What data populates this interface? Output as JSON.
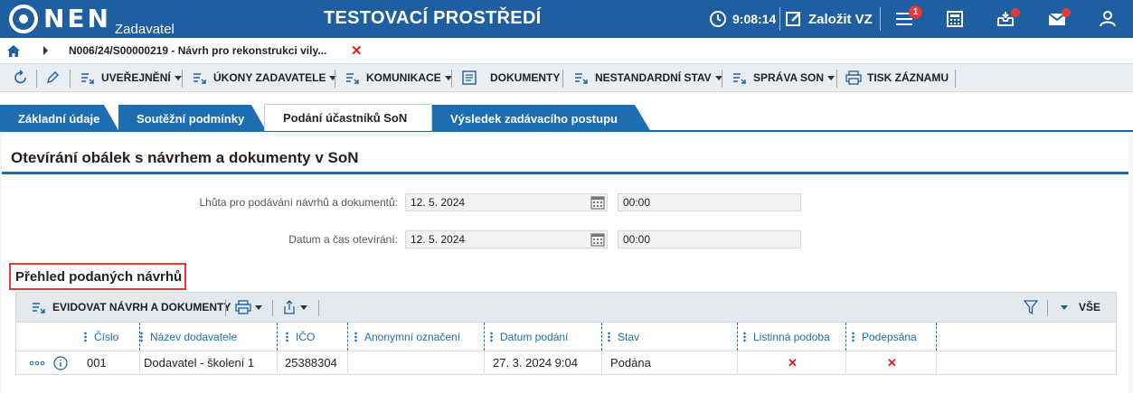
{
  "header": {
    "logo_text": "NEN",
    "logo_sub": "Zadavatel",
    "environment": "TESTOVACÍ PROSTŘEDÍ",
    "time": "9:08:14",
    "create_label": "Založit VZ",
    "notifications_count": "1"
  },
  "breadcrumb": {
    "text": "N006/24/S00000219 - Návrh pro rekonstrukci vily...",
    "close": "✕"
  },
  "toolbar": {
    "publication": "UVEŘEJNĚNÍ",
    "actions": "ÚKONY ZADAVATELE",
    "communication": "KOMUNIKACE",
    "documents": "DOKUMENTY",
    "nonstandard": "NESTANDARDNÍ STAV",
    "son_management": "SPRÁVA SON",
    "print": "TISK ZÁZNAMU"
  },
  "tabs": [
    {
      "label": "Základní údaje"
    },
    {
      "label": "Soutěžní podmínky"
    },
    {
      "label": "Podání účastníků SoN"
    },
    {
      "label": "Výsledek zadávacího postupu"
    }
  ],
  "panel": {
    "title": "Otevírání obálek s návrhem a dokumenty v SoN",
    "deadline_label": "Lhůta pro podávání návrhů a dokumentů:",
    "deadline_date": "12. 5. 2024",
    "deadline_time": "00:00",
    "opening_label": "Datum a čas otevírání:",
    "opening_date": "12. 5. 2024",
    "opening_time": "00:00"
  },
  "section": {
    "title": "Přehled podaných návrhů",
    "register_button": "EVIDOVAT NÁVRH A DOKUMENTY",
    "filter_all": "VŠE"
  },
  "grid": {
    "columns": [
      "Číslo",
      "Název dodavatele",
      "IČO",
      "Anonymní označení",
      "Datum podání",
      "Stav",
      "Listinná podoba",
      "Podepsána"
    ],
    "rows": [
      {
        "number": "001",
        "supplier": "Dodavatel - školení 1",
        "ico": "25388304",
        "anon": "",
        "date": "27. 3. 2024 9:04",
        "state": "Podána",
        "paper": "✕",
        "signed": "✕"
      }
    ]
  },
  "colors": {
    "brand": "#1d5fa0",
    "tab": "#1d6db0",
    "alert": "#e53935"
  }
}
